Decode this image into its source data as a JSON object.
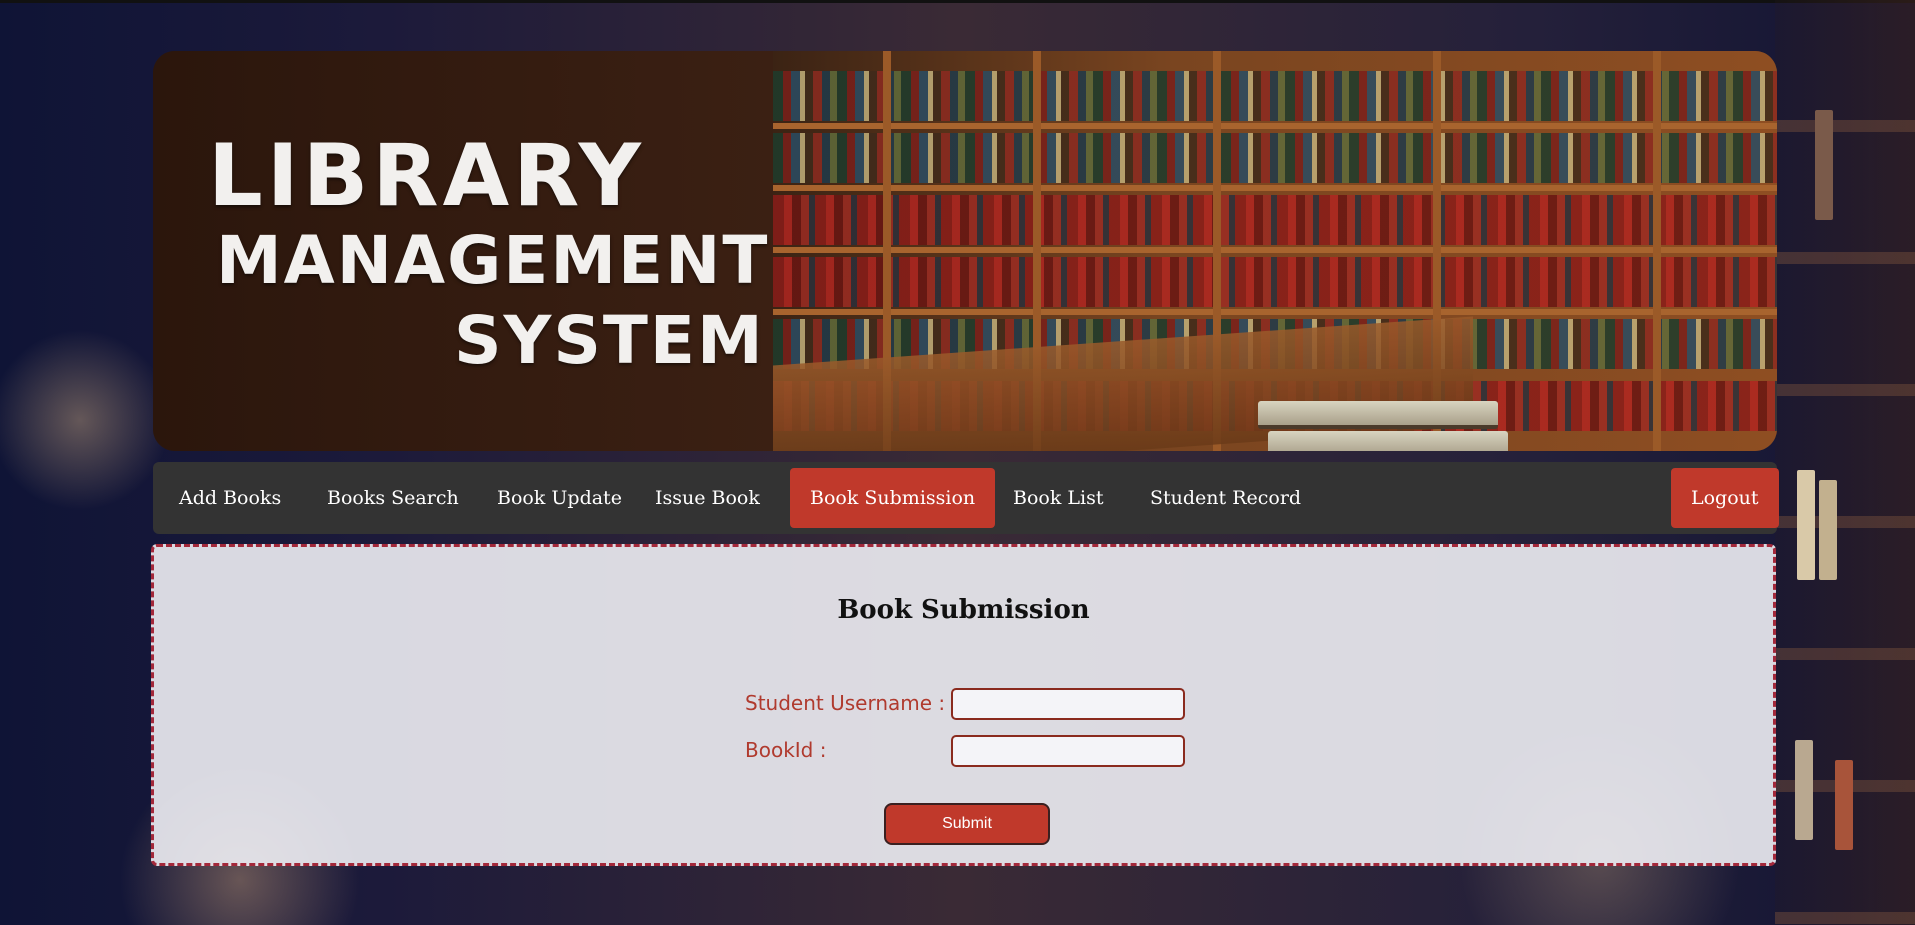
{
  "banner": {
    "title_line1": "LIBRARY",
    "title_line2": "MANAGEMENT",
    "title_line3": "SYSTEM"
  },
  "nav": {
    "items": [
      {
        "label": "Add Books",
        "active": false
      },
      {
        "label": "Books Search",
        "active": false
      },
      {
        "label": "Book Update",
        "active": false
      },
      {
        "label": "Issue Book",
        "active": false
      },
      {
        "label": "Book Submission",
        "active": true
      },
      {
        "label": "Book List",
        "active": false
      },
      {
        "label": "Student Record",
        "active": false
      }
    ],
    "logout_label": "Logout"
  },
  "form": {
    "title": "Book Submission",
    "student_username_label": "Student Username :",
    "student_username_value": "",
    "bookid_label": "BookId :",
    "bookid_value": "",
    "submit_label": "Submit"
  },
  "colors": {
    "accent": "#c0392b",
    "nav_bg": "#333333",
    "label_color": "#b03a2e",
    "panel_border": "#a3283a"
  }
}
